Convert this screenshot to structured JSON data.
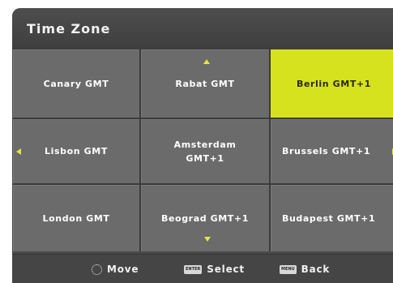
{
  "header": {
    "title": "Time Zone"
  },
  "grid": {
    "cells": [
      {
        "label": "Canary GMT"
      },
      {
        "label": "Rabat GMT"
      },
      {
        "label": "Berlin GMT+1",
        "selected": true
      },
      {
        "label": "Lisbon GMT"
      },
      {
        "label": "Amsterdam\nGMT+1"
      },
      {
        "label": "Brussels GMT+1"
      },
      {
        "label": "London GMT"
      },
      {
        "label": "Beograd GMT+1"
      },
      {
        "label": "Budapest GMT+1"
      }
    ]
  },
  "footer": {
    "move_label": "Move",
    "select_key": "ENTER",
    "select_label": "Select",
    "back_key": "MENU",
    "back_label": "Back"
  },
  "colors": {
    "selected": "#d7e21f",
    "cell": "#6b6b6b",
    "arrow": "#e0e64a"
  },
  "icons": [
    "up-arrow-icon",
    "down-arrow-icon",
    "left-arrow-icon",
    "right-arrow-icon",
    "dpad-icon",
    "enter-key-icon",
    "menu-key-icon"
  ]
}
